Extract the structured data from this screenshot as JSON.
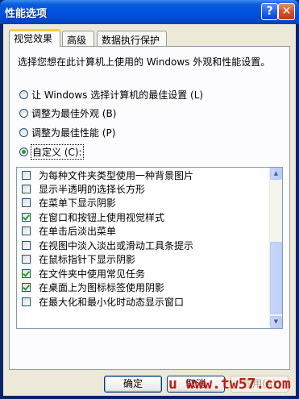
{
  "window": {
    "title": "性能选项",
    "help_label": "?",
    "close_label": "✕"
  },
  "tabs": [
    {
      "label": "视觉效果",
      "active": true
    },
    {
      "label": "高级",
      "active": false
    },
    {
      "label": "数据执行保护",
      "active": false
    }
  ],
  "description": "选择您想在此计算机上使用的 Windows 外观和性能设置。",
  "radios": [
    {
      "label": "让 Windows 选择计算机的最佳设置 (L)",
      "selected": false
    },
    {
      "label": "调整为最佳外观 (B)",
      "selected": false
    },
    {
      "label": "调整为最佳性能 (P)",
      "selected": false
    },
    {
      "label": "自定义 (C):",
      "selected": true
    }
  ],
  "options": [
    {
      "label": "为每种文件夹类型使用一种背景图片",
      "checked": false
    },
    {
      "label": "显示半透明的选择长方形",
      "checked": false
    },
    {
      "label": "在菜单下显示阴影",
      "checked": false
    },
    {
      "label": "在窗口和按钮上使用视觉样式",
      "checked": true
    },
    {
      "label": "在单击后淡出菜单",
      "checked": false
    },
    {
      "label": "在视图中淡入淡出或滑动工具条提示",
      "checked": false
    },
    {
      "label": "在鼠标指针下显示阴影",
      "checked": false
    },
    {
      "label": "在文件夹中使用常见任务",
      "checked": true
    },
    {
      "label": "在桌面上为图标标签使用阴影",
      "checked": true
    },
    {
      "label": "在最大化和最小化时动态显示窗口",
      "checked": false
    }
  ],
  "buttons": {
    "ok": "确定",
    "cancel": "取消",
    "apply": "应用(A)"
  },
  "watermark": "u www.tw57.com"
}
